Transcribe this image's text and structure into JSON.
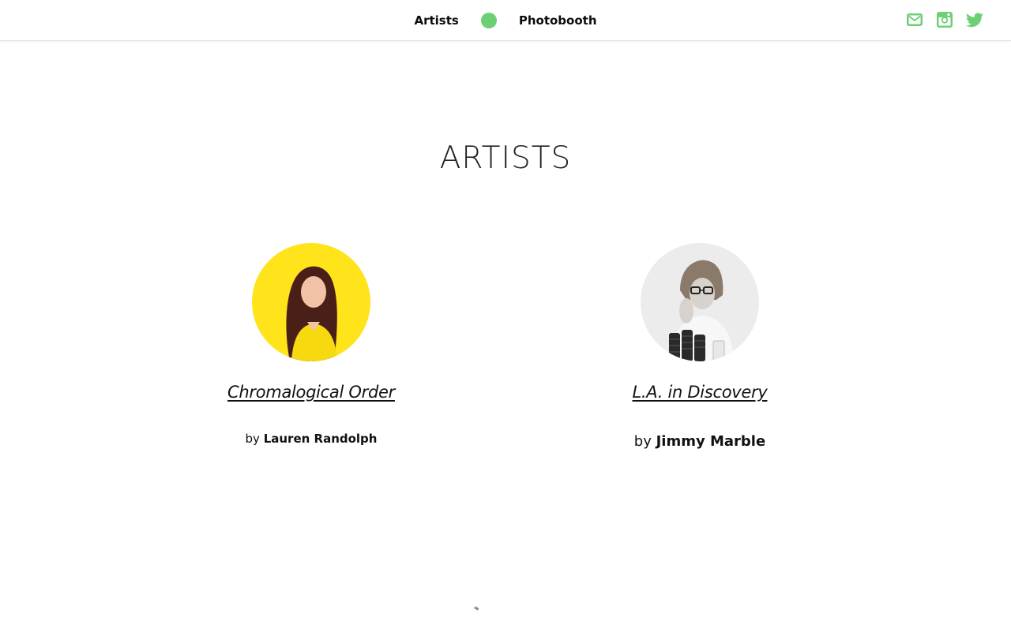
{
  "nav": {
    "left_link": "Artists",
    "right_link": "Photobooth",
    "dot_color": "#6fcf75"
  },
  "social": {
    "icons": [
      "mail-icon",
      "instagram-icon",
      "twitter-icon"
    ],
    "color": "#6fcf75"
  },
  "main": {
    "title": "ARTISTS",
    "artists": [
      {
        "collection": "Chromalogical Order",
        "by": "by",
        "name": "Lauren Randolph",
        "avatar": "yellow-portrait"
      },
      {
        "collection": "L.A. in Discovery",
        "by": "by",
        "name": "Jimmy Marble",
        "avatar": "bw-portrait"
      }
    ]
  }
}
